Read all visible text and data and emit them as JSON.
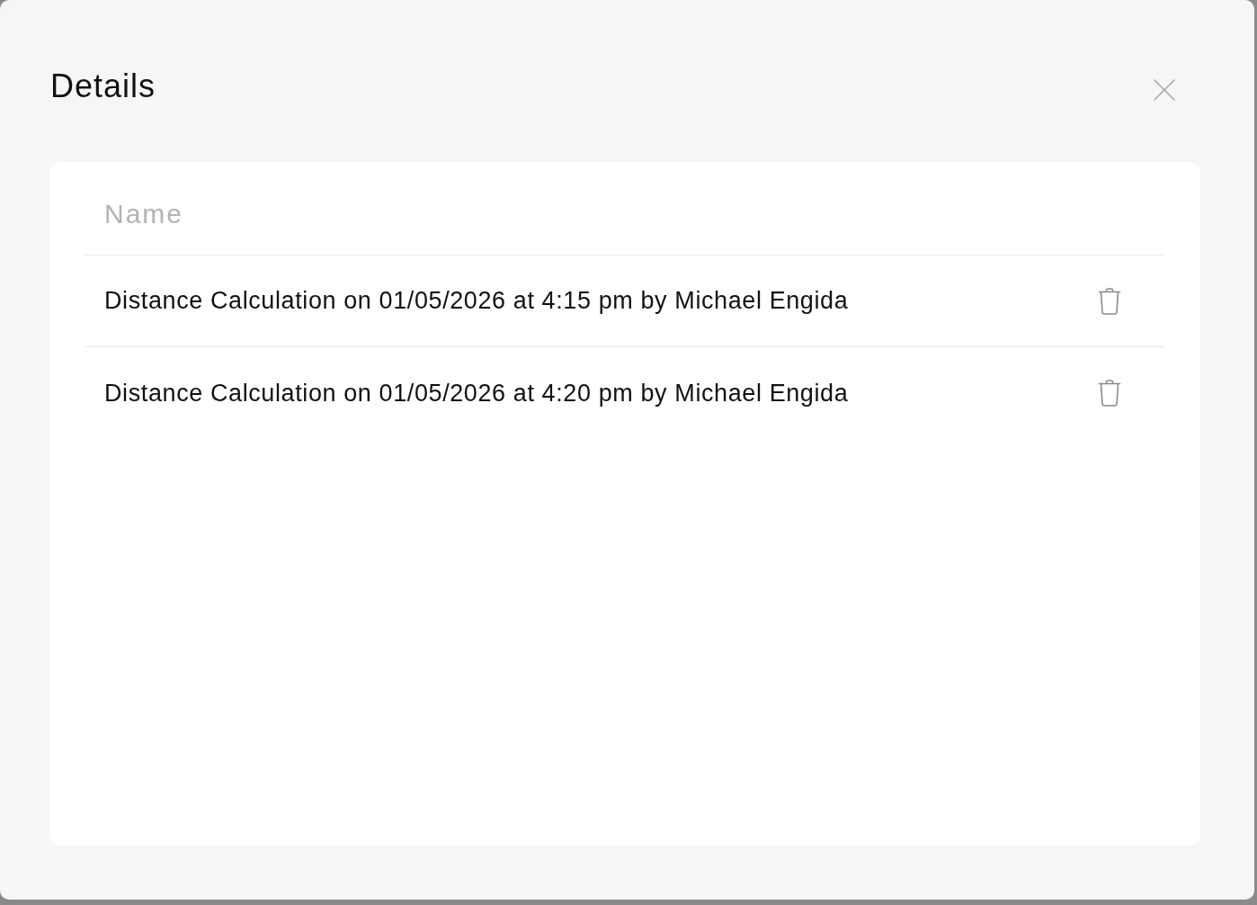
{
  "dialog": {
    "title": "Details"
  },
  "table": {
    "columns": [
      "Name"
    ],
    "rows": [
      {
        "name": "Distance Calculation on 01/05/2026 at 4:15 pm by Michael Engida"
      },
      {
        "name": "Distance Calculation on 01/05/2026 at 4:20 pm by Michael Engida"
      }
    ]
  }
}
